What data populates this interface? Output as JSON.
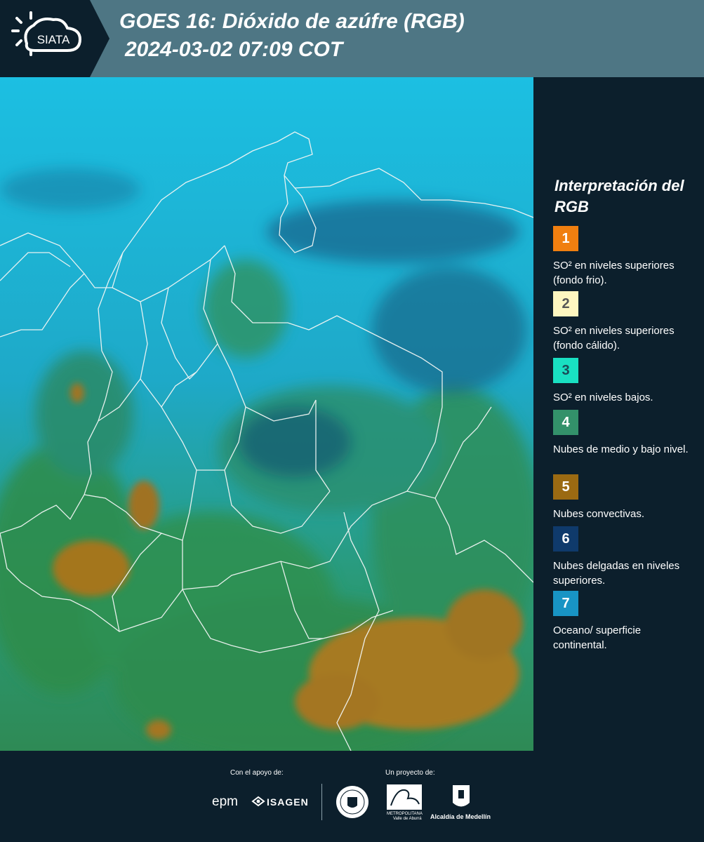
{
  "header": {
    "logo_text": "SIATA",
    "title_line1": "GOES 16: Dióxido de azúfre (RGB)",
    "title_line2": "2024-03-02 07:09 COT"
  },
  "legend": {
    "title": "Interpretación del RGB",
    "items": [
      {
        "num": "1",
        "color": "#f07f10",
        "num_color": "#ffffff",
        "label": "SO² en niveles superiores (fondo frio)."
      },
      {
        "num": "2",
        "color": "#fdf6c0",
        "num_color": "#555555",
        "label": "SO² en niveles superiores (fondo cálido)."
      },
      {
        "num": "3",
        "color": "#19e0c2",
        "num_color": "#1a4b57",
        "label": "SO² en niveles bajos."
      },
      {
        "num": "4",
        "color": "#33916a",
        "num_color": "#ffffff",
        "label": "Nubes de medio y bajo nivel."
      },
      {
        "num": "5",
        "color": "#9b6a12",
        "num_color": "#ffffff",
        "label": "Nubes convectivas."
      },
      {
        "num": "6",
        "color": "#0f3a6b",
        "num_color": "#ffffff",
        "label": "Nubes delgadas en niveles superiores."
      },
      {
        "num": "7",
        "color": "#1894c4",
        "num_color": "#ffffff",
        "label": "Oceano/ superficie continental."
      }
    ]
  },
  "footer": {
    "support_label": "Con el apoyo de:",
    "project_label": "Un proyecto de:",
    "sponsor1": "epm",
    "sponsor2": "ISAGEN",
    "partner_area_line1": "METROPOLITANA",
    "partner_area_line2": "Valle de Aburrá",
    "partner_alcaldia": "Alcaldía de Medellín"
  }
}
